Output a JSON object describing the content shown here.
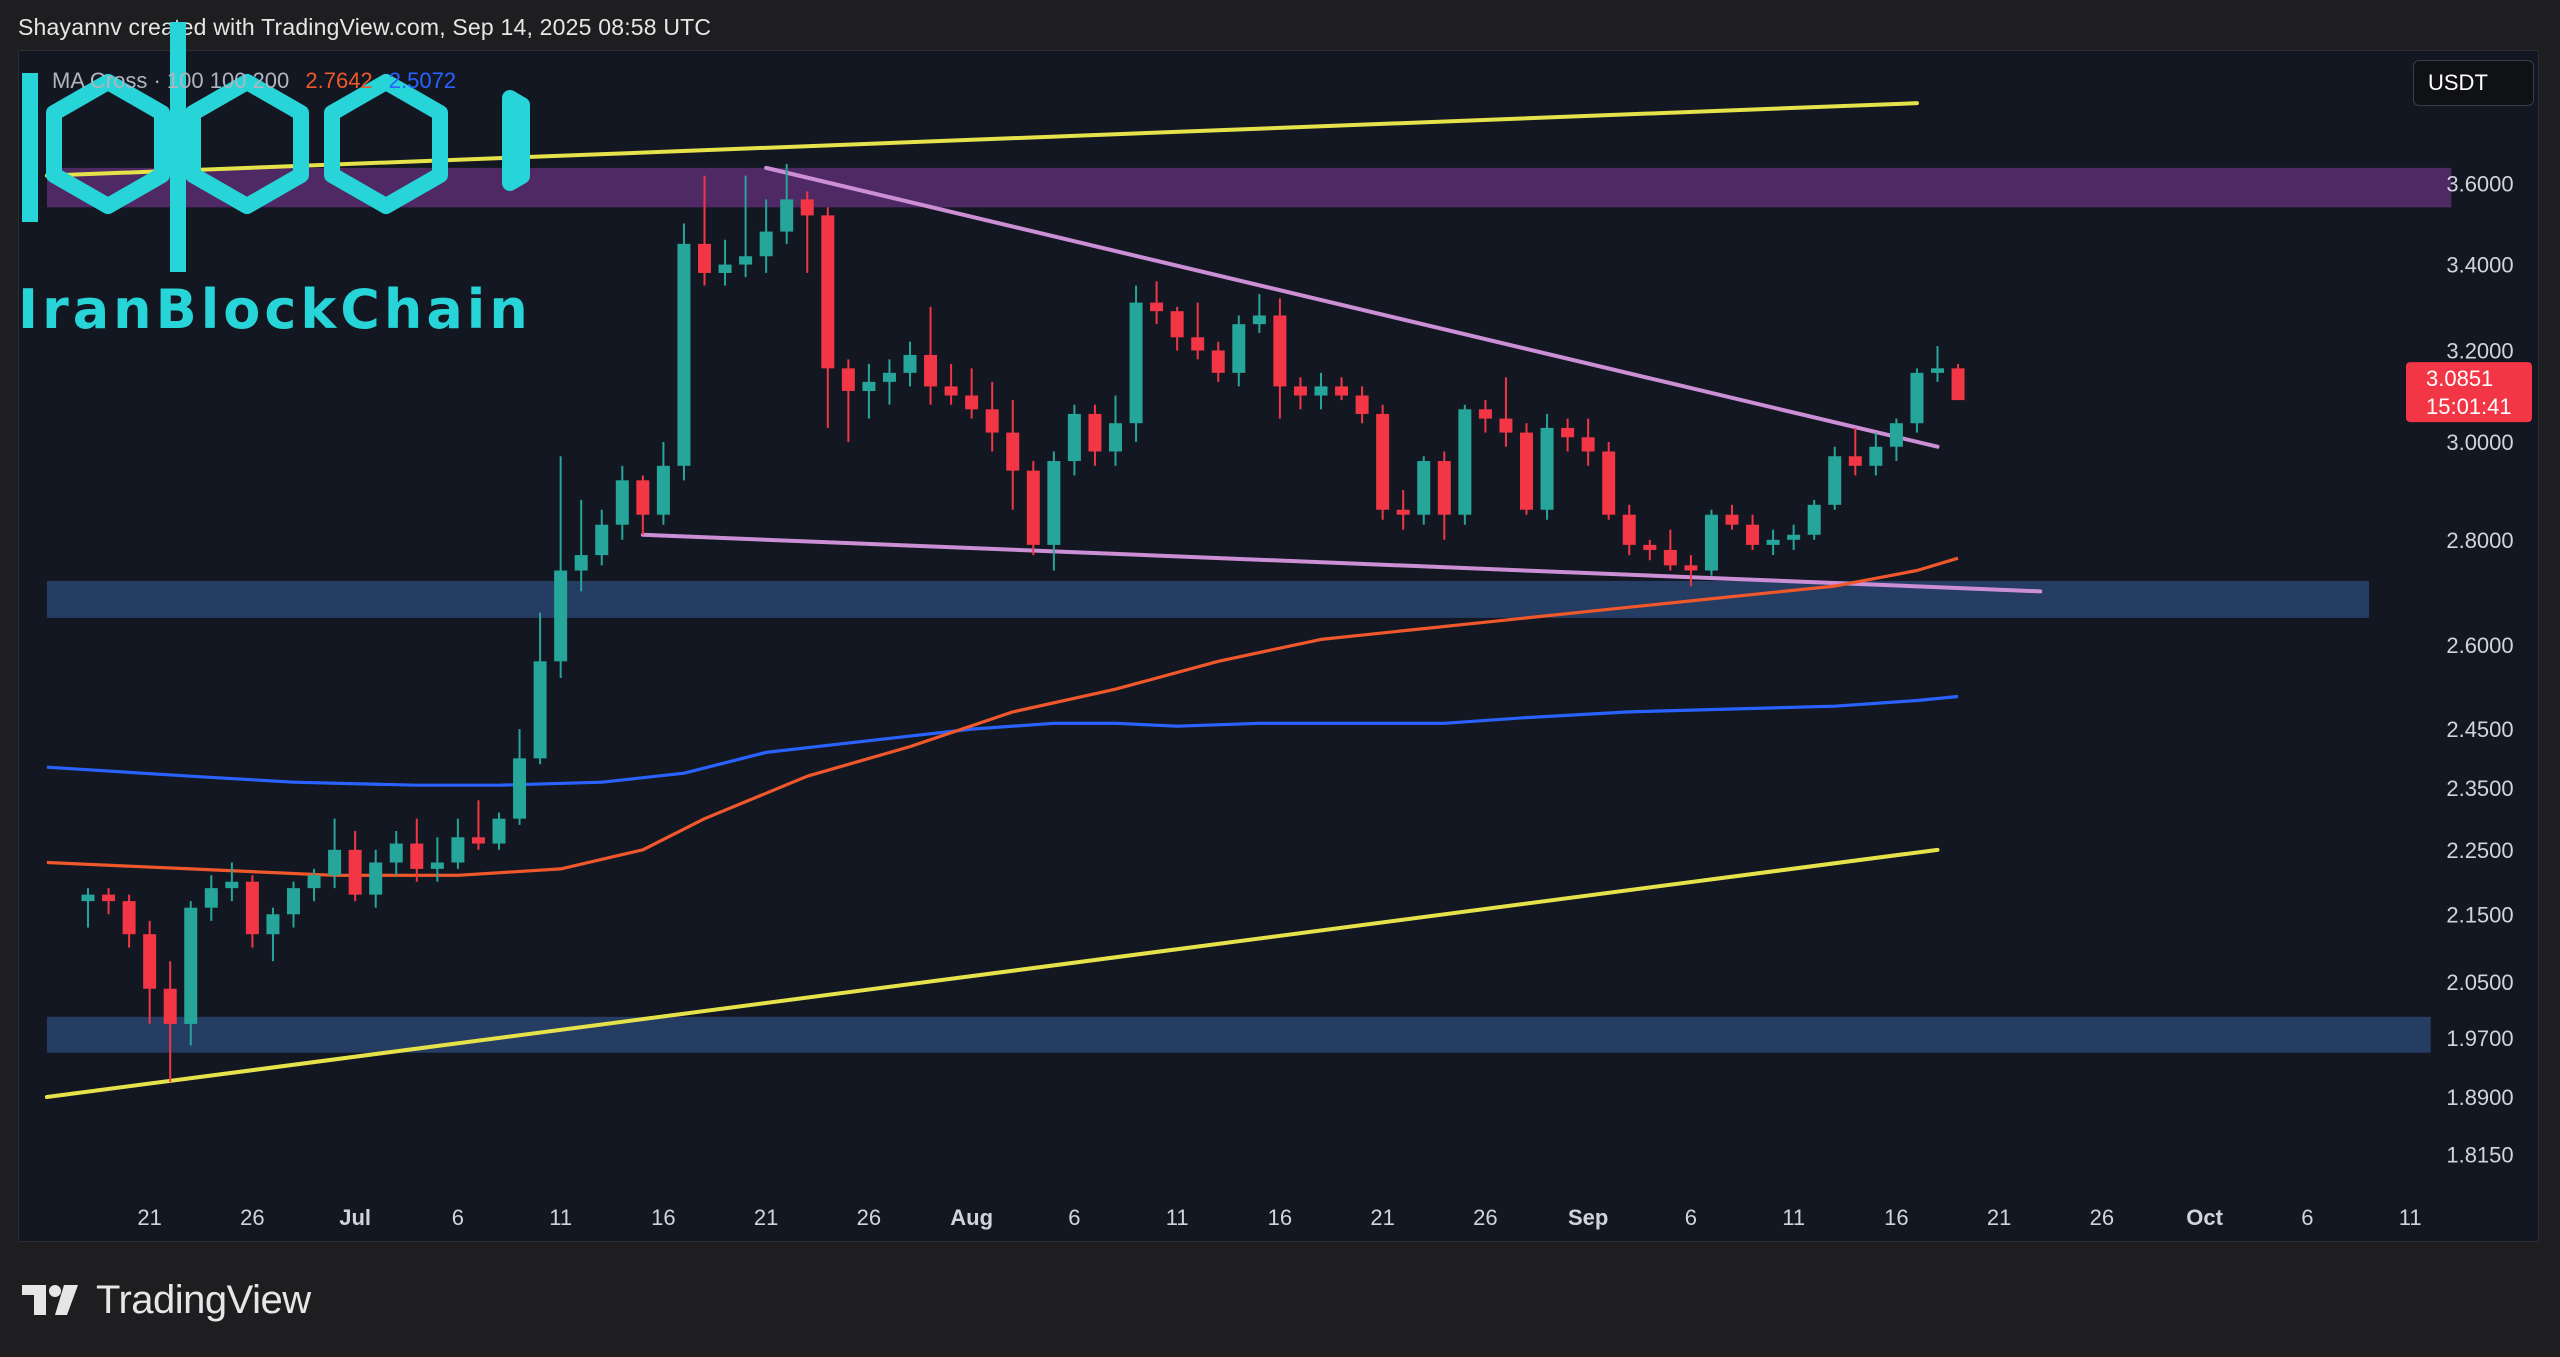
{
  "header": {
    "attribution": "Shayannv created with TradingView.com, Sep 14, 2025 08:58 UTC"
  },
  "toolbar": {
    "currency_button": "USDT"
  },
  "indicator": {
    "name": "MA Cross · 100 100 200",
    "value_fast": "2.7642",
    "value_slow": "2.5072",
    "color_fast": "#f0582b",
    "color_slow": "#2962ff"
  },
  "watermark": {
    "text": "IranBlockChain",
    "color": "#27d4d8"
  },
  "footer": {
    "brand": "TradingView"
  },
  "price_label": {
    "price": "3.0851",
    "countdown": "15:01:41",
    "color": "#f23645"
  },
  "chart_data": {
    "type": "candlestick",
    "colors": {
      "up": "#26a69a",
      "down": "#f23645",
      "background": "#131722",
      "resistance_zone": "#5b2d6e",
      "support_zone": "#2c4a7a",
      "wedge": "#cc8fd6",
      "channel": "#e6e34a"
    },
    "y_scale": "log",
    "ylim": [
      1.77,
      3.95
    ],
    "y_ticks": [
      "3.6000",
      "3.4000",
      "3.2000",
      "3.0000",
      "2.8000",
      "2.6000",
      "2.4500",
      "2.3500",
      "2.2500",
      "2.1500",
      "2.0500",
      "1.9700",
      "1.8900",
      "1.8150"
    ],
    "x_ticks": [
      "21",
      "26",
      "Jul",
      "6",
      "11",
      "16",
      "21",
      "26",
      "Aug",
      "6",
      "11",
      "16",
      "21",
      "26",
      "Sep",
      "6",
      "11",
      "16",
      "21",
      "26",
      "Oct",
      "6",
      "11"
    ],
    "x_start_date": "2025-06-18",
    "candles": [
      {
        "d": 0,
        "o": 2.17,
        "h": 2.19,
        "l": 2.13,
        "c": 2.18
      },
      {
        "d": 1,
        "o": 2.18,
        "h": 2.19,
        "l": 2.15,
        "c": 2.17
      },
      {
        "d": 2,
        "o": 2.17,
        "h": 2.18,
        "l": 2.1,
        "c": 2.12
      },
      {
        "d": 3,
        "o": 2.12,
        "h": 2.14,
        "l": 1.99,
        "c": 2.04
      },
      {
        "d": 4,
        "o": 2.04,
        "h": 2.08,
        "l": 1.91,
        "c": 1.99
      },
      {
        "d": 5,
        "o": 1.99,
        "h": 2.17,
        "l": 1.96,
        "c": 2.16
      },
      {
        "d": 6,
        "o": 2.16,
        "h": 2.21,
        "l": 2.14,
        "c": 2.19
      },
      {
        "d": 7,
        "o": 2.19,
        "h": 2.23,
        "l": 2.17,
        "c": 2.2
      },
      {
        "d": 8,
        "o": 2.2,
        "h": 2.21,
        "l": 2.1,
        "c": 2.12
      },
      {
        "d": 9,
        "o": 2.12,
        "h": 2.16,
        "l": 2.08,
        "c": 2.15
      },
      {
        "d": 10,
        "o": 2.15,
        "h": 2.2,
        "l": 2.13,
        "c": 2.19
      },
      {
        "d": 11,
        "o": 2.19,
        "h": 2.22,
        "l": 2.17,
        "c": 2.21
      },
      {
        "d": 12,
        "o": 2.21,
        "h": 2.3,
        "l": 2.19,
        "c": 2.25
      },
      {
        "d": 13,
        "o": 2.25,
        "h": 2.28,
        "l": 2.17,
        "c": 2.18
      },
      {
        "d": 14,
        "o": 2.18,
        "h": 2.25,
        "l": 2.16,
        "c": 2.23
      },
      {
        "d": 15,
        "o": 2.23,
        "h": 2.28,
        "l": 2.21,
        "c": 2.26
      },
      {
        "d": 16,
        "o": 2.26,
        "h": 2.3,
        "l": 2.2,
        "c": 2.22
      },
      {
        "d": 17,
        "o": 2.22,
        "h": 2.27,
        "l": 2.2,
        "c": 2.23
      },
      {
        "d": 18,
        "o": 2.23,
        "h": 2.3,
        "l": 2.22,
        "c": 2.27
      },
      {
        "d": 19,
        "o": 2.27,
        "h": 2.33,
        "l": 2.25,
        "c": 2.26
      },
      {
        "d": 20,
        "o": 2.26,
        "h": 2.31,
        "l": 2.25,
        "c": 2.3
      },
      {
        "d": 21,
        "o": 2.3,
        "h": 2.45,
        "l": 2.29,
        "c": 2.4
      },
      {
        "d": 22,
        "o": 2.4,
        "h": 2.66,
        "l": 2.39,
        "c": 2.57
      },
      {
        "d": 23,
        "o": 2.57,
        "h": 2.97,
        "l": 2.54,
        "c": 2.74
      },
      {
        "d": 24,
        "o": 2.74,
        "h": 2.88,
        "l": 2.7,
        "c": 2.77
      },
      {
        "d": 25,
        "o": 2.77,
        "h": 2.86,
        "l": 2.75,
        "c": 2.83
      },
      {
        "d": 26,
        "o": 2.83,
        "h": 2.95,
        "l": 2.8,
        "c": 2.92
      },
      {
        "d": 27,
        "o": 2.92,
        "h": 2.93,
        "l": 2.81,
        "c": 2.85
      },
      {
        "d": 28,
        "o": 2.85,
        "h": 3.0,
        "l": 2.83,
        "c": 2.95
      },
      {
        "d": 29,
        "o": 2.95,
        "h": 3.5,
        "l": 2.92,
        "c": 3.45
      },
      {
        "d": 30,
        "o": 3.45,
        "h": 3.62,
        "l": 3.35,
        "c": 3.38
      },
      {
        "d": 31,
        "o": 3.38,
        "h": 3.46,
        "l": 3.35,
        "c": 3.4
      },
      {
        "d": 32,
        "o": 3.4,
        "h": 3.62,
        "l": 3.37,
        "c": 3.42
      },
      {
        "d": 33,
        "o": 3.42,
        "h": 3.56,
        "l": 3.38,
        "c": 3.48
      },
      {
        "d": 34,
        "o": 3.48,
        "h": 3.65,
        "l": 3.45,
        "c": 3.56
      },
      {
        "d": 35,
        "o": 3.56,
        "h": 3.58,
        "l": 3.38,
        "c": 3.52
      },
      {
        "d": 36,
        "o": 3.52,
        "h": 3.54,
        "l": 3.03,
        "c": 3.16
      },
      {
        "d": 37,
        "o": 3.16,
        "h": 3.18,
        "l": 3.0,
        "c": 3.11
      },
      {
        "d": 38,
        "o": 3.11,
        "h": 3.17,
        "l": 3.05,
        "c": 3.13
      },
      {
        "d": 39,
        "o": 3.13,
        "h": 3.18,
        "l": 3.08,
        "c": 3.15
      },
      {
        "d": 40,
        "o": 3.15,
        "h": 3.22,
        "l": 3.12,
        "c": 3.19
      },
      {
        "d": 41,
        "o": 3.19,
        "h": 3.3,
        "l": 3.08,
        "c": 3.12
      },
      {
        "d": 42,
        "o": 3.12,
        "h": 3.17,
        "l": 3.08,
        "c": 3.1
      },
      {
        "d": 43,
        "o": 3.1,
        "h": 3.16,
        "l": 3.05,
        "c": 3.07
      },
      {
        "d": 44,
        "o": 3.07,
        "h": 3.13,
        "l": 2.98,
        "c": 3.02
      },
      {
        "d": 45,
        "o": 3.02,
        "h": 3.09,
        "l": 2.86,
        "c": 2.94
      },
      {
        "d": 46,
        "o": 2.94,
        "h": 2.96,
        "l": 2.77,
        "c": 2.79
      },
      {
        "d": 47,
        "o": 2.79,
        "h": 2.98,
        "l": 2.74,
        "c": 2.96
      },
      {
        "d": 48,
        "o": 2.96,
        "h": 3.08,
        "l": 2.93,
        "c": 3.06
      },
      {
        "d": 49,
        "o": 3.06,
        "h": 3.08,
        "l": 2.95,
        "c": 2.98
      },
      {
        "d": 50,
        "o": 2.98,
        "h": 3.1,
        "l": 2.95,
        "c": 3.04
      },
      {
        "d": 51,
        "o": 3.04,
        "h": 3.35,
        "l": 3.0,
        "c": 3.31
      },
      {
        "d": 52,
        "o": 3.31,
        "h": 3.36,
        "l": 3.26,
        "c": 3.29
      },
      {
        "d": 53,
        "o": 3.29,
        "h": 3.3,
        "l": 3.2,
        "c": 3.23
      },
      {
        "d": 54,
        "o": 3.23,
        "h": 3.31,
        "l": 3.18,
        "c": 3.2
      },
      {
        "d": 55,
        "o": 3.2,
        "h": 3.22,
        "l": 3.13,
        "c": 3.15
      },
      {
        "d": 56,
        "o": 3.15,
        "h": 3.28,
        "l": 3.12,
        "c": 3.26
      },
      {
        "d": 57,
        "o": 3.26,
        "h": 3.33,
        "l": 3.24,
        "c": 3.28
      },
      {
        "d": 58,
        "o": 3.28,
        "h": 3.32,
        "l": 3.05,
        "c": 3.12
      },
      {
        "d": 59,
        "o": 3.12,
        "h": 3.14,
        "l": 3.07,
        "c": 3.1
      },
      {
        "d": 60,
        "o": 3.1,
        "h": 3.15,
        "l": 3.07,
        "c": 3.12
      },
      {
        "d": 61,
        "o": 3.12,
        "h": 3.14,
        "l": 3.09,
        "c": 3.1
      },
      {
        "d": 62,
        "o": 3.1,
        "h": 3.12,
        "l": 3.04,
        "c": 3.06
      },
      {
        "d": 63,
        "o": 3.06,
        "h": 3.08,
        "l": 2.84,
        "c": 2.86
      },
      {
        "d": 64,
        "o": 2.86,
        "h": 2.9,
        "l": 2.82,
        "c": 2.85
      },
      {
        "d": 65,
        "o": 2.85,
        "h": 2.97,
        "l": 2.83,
        "c": 2.96
      },
      {
        "d": 66,
        "o": 2.96,
        "h": 2.98,
        "l": 2.8,
        "c": 2.85
      },
      {
        "d": 67,
        "o": 2.85,
        "h": 3.08,
        "l": 2.83,
        "c": 3.07
      },
      {
        "d": 68,
        "o": 3.07,
        "h": 3.09,
        "l": 3.02,
        "c": 3.05
      },
      {
        "d": 69,
        "o": 3.05,
        "h": 3.14,
        "l": 2.99,
        "c": 3.02
      },
      {
        "d": 70,
        "o": 3.02,
        "h": 3.04,
        "l": 2.85,
        "c": 2.86
      },
      {
        "d": 71,
        "o": 2.86,
        "h": 3.06,
        "l": 2.84,
        "c": 3.03
      },
      {
        "d": 72,
        "o": 3.03,
        "h": 3.05,
        "l": 2.98,
        "c": 3.01
      },
      {
        "d": 73,
        "o": 3.01,
        "h": 3.05,
        "l": 2.95,
        "c": 2.98
      },
      {
        "d": 74,
        "o": 2.98,
        "h": 3.0,
        "l": 2.84,
        "c": 2.85
      },
      {
        "d": 75,
        "o": 2.85,
        "h": 2.87,
        "l": 2.77,
        "c": 2.79
      },
      {
        "d": 76,
        "o": 2.79,
        "h": 2.8,
        "l": 2.76,
        "c": 2.78
      },
      {
        "d": 77,
        "o": 2.78,
        "h": 2.82,
        "l": 2.74,
        "c": 2.75
      },
      {
        "d": 78,
        "o": 2.75,
        "h": 2.77,
        "l": 2.71,
        "c": 2.74
      },
      {
        "d": 79,
        "o": 2.74,
        "h": 2.86,
        "l": 2.73,
        "c": 2.85
      },
      {
        "d": 80,
        "o": 2.85,
        "h": 2.87,
        "l": 2.82,
        "c": 2.83
      },
      {
        "d": 81,
        "o": 2.83,
        "h": 2.85,
        "l": 2.78,
        "c": 2.79
      },
      {
        "d": 82,
        "o": 2.79,
        "h": 2.82,
        "l": 2.77,
        "c": 2.8
      },
      {
        "d": 83,
        "o": 2.8,
        "h": 2.83,
        "l": 2.78,
        "c": 2.81
      },
      {
        "d": 84,
        "o": 2.81,
        "h": 2.88,
        "l": 2.8,
        "c": 2.87
      },
      {
        "d": 85,
        "o": 2.87,
        "h": 2.99,
        "l": 2.86,
        "c": 2.97
      },
      {
        "d": 86,
        "o": 2.97,
        "h": 3.03,
        "l": 2.93,
        "c": 2.95
      },
      {
        "d": 87,
        "o": 2.95,
        "h": 3.02,
        "l": 2.93,
        "c": 2.99
      },
      {
        "d": 88,
        "o": 2.99,
        "h": 3.05,
        "l": 2.96,
        "c": 3.04
      },
      {
        "d": 89,
        "o": 3.04,
        "h": 3.16,
        "l": 3.02,
        "c": 3.15
      },
      {
        "d": 90,
        "o": 3.15,
        "h": 3.21,
        "l": 3.13,
        "c": 3.16
      },
      {
        "d": 91,
        "o": 3.16,
        "h": 3.17,
        "l": 3.09,
        "c": 3.09
      }
    ],
    "ma_fast": {
      "name": "MA 100",
      "color": "#f0582b",
      "points": [
        [
          -2,
          2.23
        ],
        [
          5,
          2.22
        ],
        [
          12,
          2.21
        ],
        [
          18,
          2.21
        ],
        [
          23,
          2.22
        ],
        [
          27,
          2.25
        ],
        [
          30,
          2.3
        ],
        [
          35,
          2.37
        ],
        [
          40,
          2.42
        ],
        [
          45,
          2.48
        ],
        [
          50,
          2.52
        ],
        [
          55,
          2.57
        ],
        [
          60,
          2.61
        ],
        [
          65,
          2.63
        ],
        [
          70,
          2.65
        ],
        [
          75,
          2.67
        ],
        [
          80,
          2.69
        ],
        [
          85,
          2.71
        ],
        [
          89,
          2.74
        ],
        [
          91,
          2.764
        ]
      ]
    },
    "ma_slow": {
      "name": "MA 200",
      "color": "#2962ff",
      "points": [
        [
          -2,
          2.385
        ],
        [
          5,
          2.37
        ],
        [
          10,
          2.36
        ],
        [
          16,
          2.355
        ],
        [
          20,
          2.355
        ],
        [
          25,
          2.36
        ],
        [
          29,
          2.375
        ],
        [
          33,
          2.41
        ],
        [
          38,
          2.43
        ],
        [
          43,
          2.45
        ],
        [
          47,
          2.46
        ],
        [
          50,
          2.46
        ],
        [
          53,
          2.455
        ],
        [
          57,
          2.46
        ],
        [
          62,
          2.46
        ],
        [
          66,
          2.46
        ],
        [
          70,
          2.47
        ],
        [
          75,
          2.48
        ],
        [
          80,
          2.485
        ],
        [
          85,
          2.49
        ],
        [
          89,
          2.5
        ],
        [
          91,
          2.507
        ]
      ]
    },
    "zones": [
      {
        "name": "resistance",
        "top": 3.64,
        "bottom": 3.54,
        "x_start": -2,
        "x_end": 115
      },
      {
        "name": "support-upper",
        "top": 2.72,
        "bottom": 2.65,
        "x_start": -2,
        "x_end": 111
      },
      {
        "name": "support-lower",
        "top": 2.0,
        "bottom": 1.95,
        "x_start": -2,
        "x_end": 114
      }
    ],
    "trendlines": [
      {
        "name": "wedge-upper",
        "color": "#cc8fd6",
        "from": [
          33,
          3.64
        ],
        "to": [
          90,
          2.99
        ]
      },
      {
        "name": "wedge-lower",
        "color": "#cc8fd6",
        "from": [
          27,
          2.81
        ],
        "to": [
          95,
          2.7
        ]
      },
      {
        "name": "channel-upper",
        "color": "#e6e34a",
        "from": [
          -2,
          3.62
        ],
        "to": [
          89,
          3.81
        ]
      },
      {
        "name": "channel-lower",
        "color": "#e6e34a",
        "from": [
          -2,
          1.89
        ],
        "to": [
          90,
          2.25
        ]
      }
    ]
  }
}
